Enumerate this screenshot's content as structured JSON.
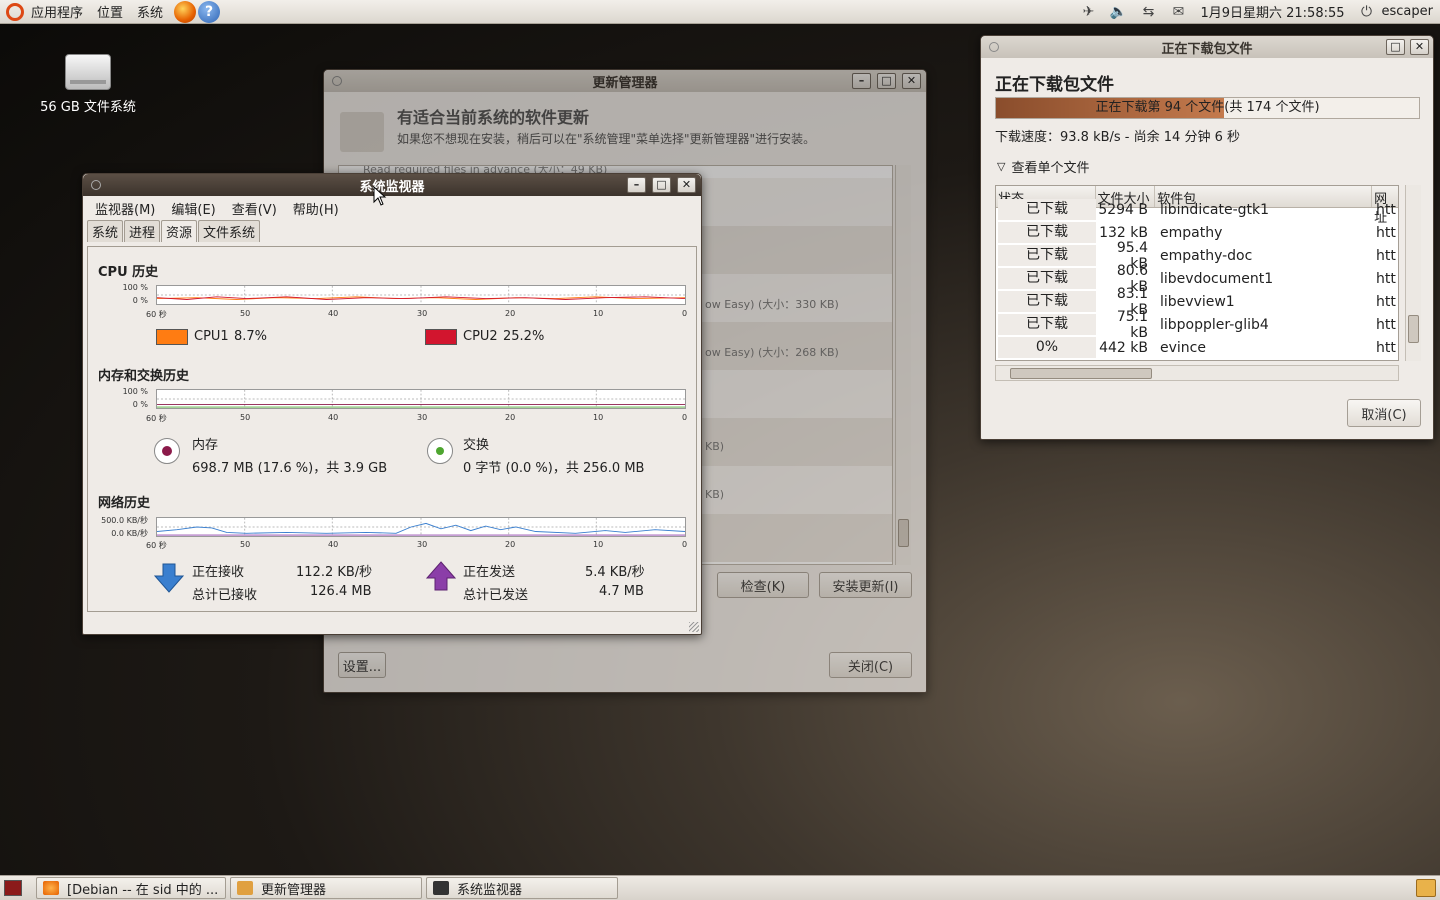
{
  "topbar": {
    "menu_apps": "应用程序",
    "menu_places": "位置",
    "menu_system": "系统",
    "datetime": "1月9日星期六 21:58:55",
    "user": "escaper"
  },
  "desktop": {
    "drive_label": "56 GB 文件系统"
  },
  "update_manager": {
    "title": "更新管理器",
    "heading": "有适合当前系统的软件更新",
    "subheading": "如果您不想现在安装，稍后可以在\"系统管理\"菜单选择\"更新管理器\"进行安装。",
    "list_line_top": "Read required files in advance (大小：49 KB)",
    "frag1": "ow Easy) (大小：330 KB)",
    "frag2": "ow Easy) (大小：268 KB)",
    "frag3": "KB)",
    "frag4": "KB)",
    "check_label": "检查(K)",
    "install_label": "安装更新(I)",
    "settings_label": "设置...",
    "close_label": "关闭(C)"
  },
  "download": {
    "title": "正在下载包文件",
    "heading": "正在下载包文件",
    "progress_text": "正在下载第 94 个文件(共 174 个文件)",
    "progress": 0.54,
    "speed": "下载速度：93.8 kB/s - 尚余 14 分钟 6 秒",
    "expander": "查看单个文件",
    "columns": [
      "状态",
      "文件大小",
      "软件包",
      "网址"
    ],
    "rows": [
      {
        "status": "已下载",
        "size": "5294 B",
        "pkg": "libindicate-gtk1",
        "url": "htt"
      },
      {
        "status": "已下载",
        "size": "132 kB",
        "pkg": "empathy",
        "url": "htt"
      },
      {
        "status": "已下载",
        "size": "95.4 kB",
        "pkg": "empathy-doc",
        "url": "htt"
      },
      {
        "status": "已下载",
        "size": "80.6 kB",
        "pkg": "libevdocument1",
        "url": "htt"
      },
      {
        "status": "已下载",
        "size": "83.1 kB",
        "pkg": "libevview1",
        "url": "htt"
      },
      {
        "status": "已下载",
        "size": "75.1 kB",
        "pkg": "libpoppler-glib4",
        "url": "htt"
      },
      {
        "status": "0%",
        "size": "442 kB",
        "pkg": "evince",
        "url": "htt"
      }
    ],
    "cancel_label": "取消(C)"
  },
  "sysmon": {
    "title": "系统监视器",
    "menus": [
      "监视器(M)",
      "编辑(E)",
      "查看(V)",
      "帮助(H)"
    ],
    "tabs": [
      "系统",
      "进程",
      "资源",
      "文件系统"
    ],
    "cpu_title": "CPU 历史",
    "mem_title": "内存和交换历史",
    "net_title": "网络历史",
    "y_cpu": [
      "100 %",
      "0 %"
    ],
    "y_net": [
      "500.0 KB/秒",
      "0.0 KB/秒"
    ],
    "x_ticks": [
      "60 秒",
      "50",
      "40",
      "30",
      "20",
      "10",
      "0"
    ],
    "cpu1_label": "CPU1",
    "cpu1_value": "8.7%",
    "cpu2_label": "CPU2",
    "cpu2_value": "25.2%",
    "mem_label": "内存",
    "mem_value": "698.7 MB (17.6 %)，共 3.9 GB",
    "swap_label": "交换",
    "swap_value": "0 字节 (0.0 %)，共 256.0 MB",
    "recv_label": "正在接收",
    "recv_value": "112.2 KB/秒",
    "recv_total_label": "总计已接收",
    "recv_total": "126.4 MB",
    "send_label": "正在发送",
    "send_value": "5.4 KB/秒",
    "send_total_label": "总计已发送",
    "send_total": "4.7 MB"
  },
  "taskbar": {
    "items": [
      "[Debian -- 在 sid 中的 ...",
      "更新管理器",
      "系统监视器"
    ]
  },
  "colors": {
    "cpu1": "#ff7c12",
    "cpu2": "#d2152e",
    "mem": "#8b1a4a",
    "swap": "#4ea630",
    "recv": "#3a7fcf",
    "send": "#8b3ea8",
    "titlebar_active": "#4a3f36"
  }
}
